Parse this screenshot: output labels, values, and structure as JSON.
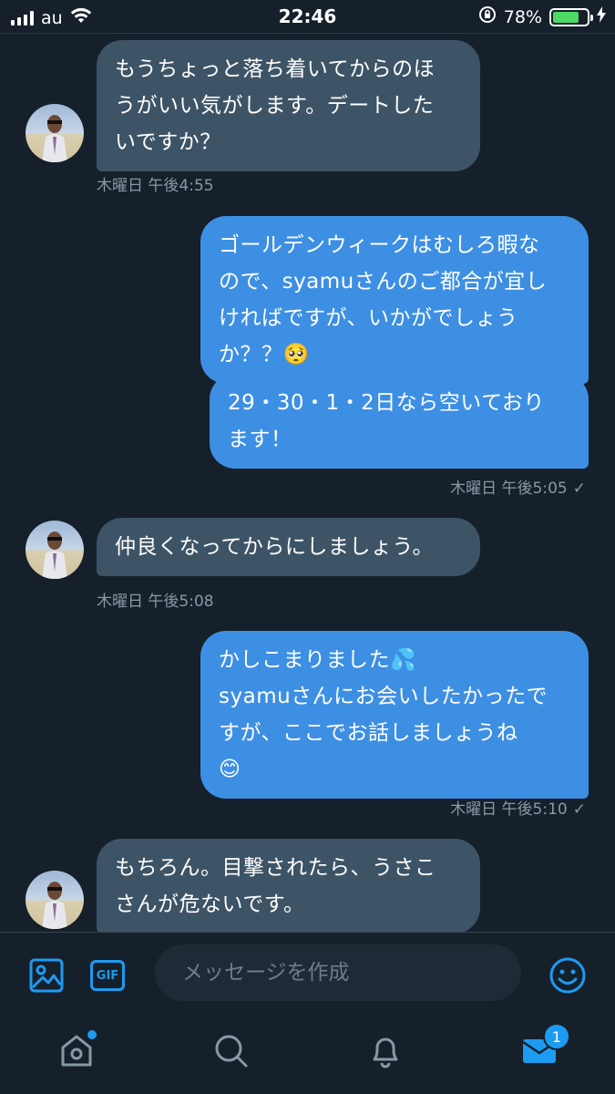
{
  "status_bar": {
    "carrier": "au",
    "time": "22:46",
    "battery_percent": "78%",
    "battery_level": 0.78,
    "battery_color": "#4cd964"
  },
  "messages": [
    {
      "side": "received",
      "text": "もうちょっと落ち着いてからのほ\nうがいい気がします。デートした\nいですか？",
      "time": "木曜日 午後4:55"
    },
    {
      "side": "sent",
      "text": "ゴールデンウィークはむしろ暇な\nので、syamuさんのご都合が宜し\nければですが、いかがでしょう\nか？？🥺"
    },
    {
      "side": "sent",
      "text": "29・30・1・2日なら空いており\nます！",
      "time": "木曜日 午後5:05",
      "read_mark": "✓"
    },
    {
      "side": "received",
      "text": "仲良くなってからにしましょう。",
      "time": "木曜日 午後5:08"
    },
    {
      "side": "sent",
      "text": "かしこまりました💦\nsyamuさんにお会いしたかったで\nすが、ここでお話しましょうね\n😊",
      "time": "木曜日 午後5:10",
      "read_mark": "✓"
    },
    {
      "side": "received",
      "text": "もちろん。目撃されたら、うさこ\nさんが危ないです。"
    }
  ],
  "composer": {
    "placeholder": "メッセージを作成",
    "gif_label": "GIF",
    "icons": [
      "image-icon",
      "gif-icon",
      "emoji-icon"
    ]
  },
  "tab_bar": {
    "icons": [
      "home-icon",
      "search-icon",
      "notifications-icon",
      "messages-icon"
    ],
    "messages_badge": "1"
  },
  "colors": {
    "background": "#15202b",
    "accent": "#1d9bf0",
    "sent_bubble": "#3d8fe3",
    "received_bubble": "#3d5466",
    "timestamp": "#8899a6"
  }
}
